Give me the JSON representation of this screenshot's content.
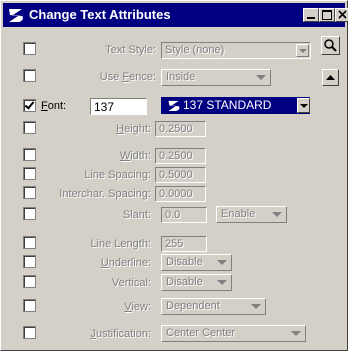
{
  "window": {
    "title": "Change Text Attributes",
    "icons": {
      "app": "microstation-logo-icon",
      "minimize": "minimize-icon",
      "maximize": "maximize-icon",
      "close": "close-icon"
    }
  },
  "tools": {
    "magnifier_icon": "magnifier-icon",
    "up_arrow_icon": "triangle-up-icon"
  },
  "fields": {
    "text_style": {
      "label": "Text Style:",
      "value": "Style (none)"
    },
    "use_fence": {
      "label_accel": "F",
      "label_pre": "Use ",
      "label_post": "ence:",
      "value": "Inside"
    },
    "font": {
      "label_accel": "F",
      "label_post": "ont:",
      "value": "137",
      "selected_font": "137 STANDARD"
    },
    "height": {
      "label_accel": "H",
      "label_post": "eight:",
      "value": "0.2500"
    },
    "width": {
      "label_accel": "W",
      "label_post": "idth:",
      "value": "0.2500"
    },
    "line_spacing": {
      "label": "Line Spacing:",
      "value": "0.5000"
    },
    "interchar_spacing": {
      "label": "Interchar. Spacing:",
      "value": "0.0000"
    },
    "slant": {
      "label": "Slant:",
      "value": "0.0",
      "mode": "Enable"
    },
    "line_length": {
      "label": "Line Length:",
      "value": "255"
    },
    "underline": {
      "label_accel": "U",
      "label_post": "nderline:",
      "value": "Disable"
    },
    "vertical": {
      "label": "Vertical:",
      "value": "Disable"
    },
    "view": {
      "label_accel": "V",
      "label_post": "iew:",
      "value": "Dependent"
    },
    "justification": {
      "label_accel": "J",
      "label_post": "ustification:",
      "value": "Center Center"
    }
  },
  "colors": {
    "title_bg": "#000080",
    "face": "#d4d0c8",
    "disabled_text": "#808080"
  }
}
